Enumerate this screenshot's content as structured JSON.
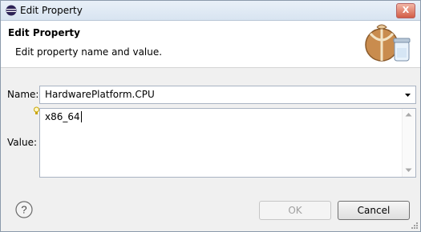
{
  "window": {
    "title": "Edit Property",
    "close_label": "X"
  },
  "banner": {
    "title": "Edit Property",
    "message": "Edit property name and value."
  },
  "form": {
    "name_label": "Name:",
    "name_value": "HardwarePlatform.CPU",
    "value_label": "Value:",
    "value_text": "x86_64"
  },
  "buttons": {
    "ok": "OK",
    "cancel": "Cancel",
    "ok_enabled": false
  },
  "icons": {
    "title": "eclipse-icon",
    "banner": "package-jar-icon",
    "hint": "lightbulb-hint-icon",
    "help": "help-icon",
    "dropdown": "chevron-down-icon"
  },
  "colors": {
    "accent": "#d25d46",
    "border": "#a9b3c2",
    "disabled_text": "#a0a0a0"
  }
}
